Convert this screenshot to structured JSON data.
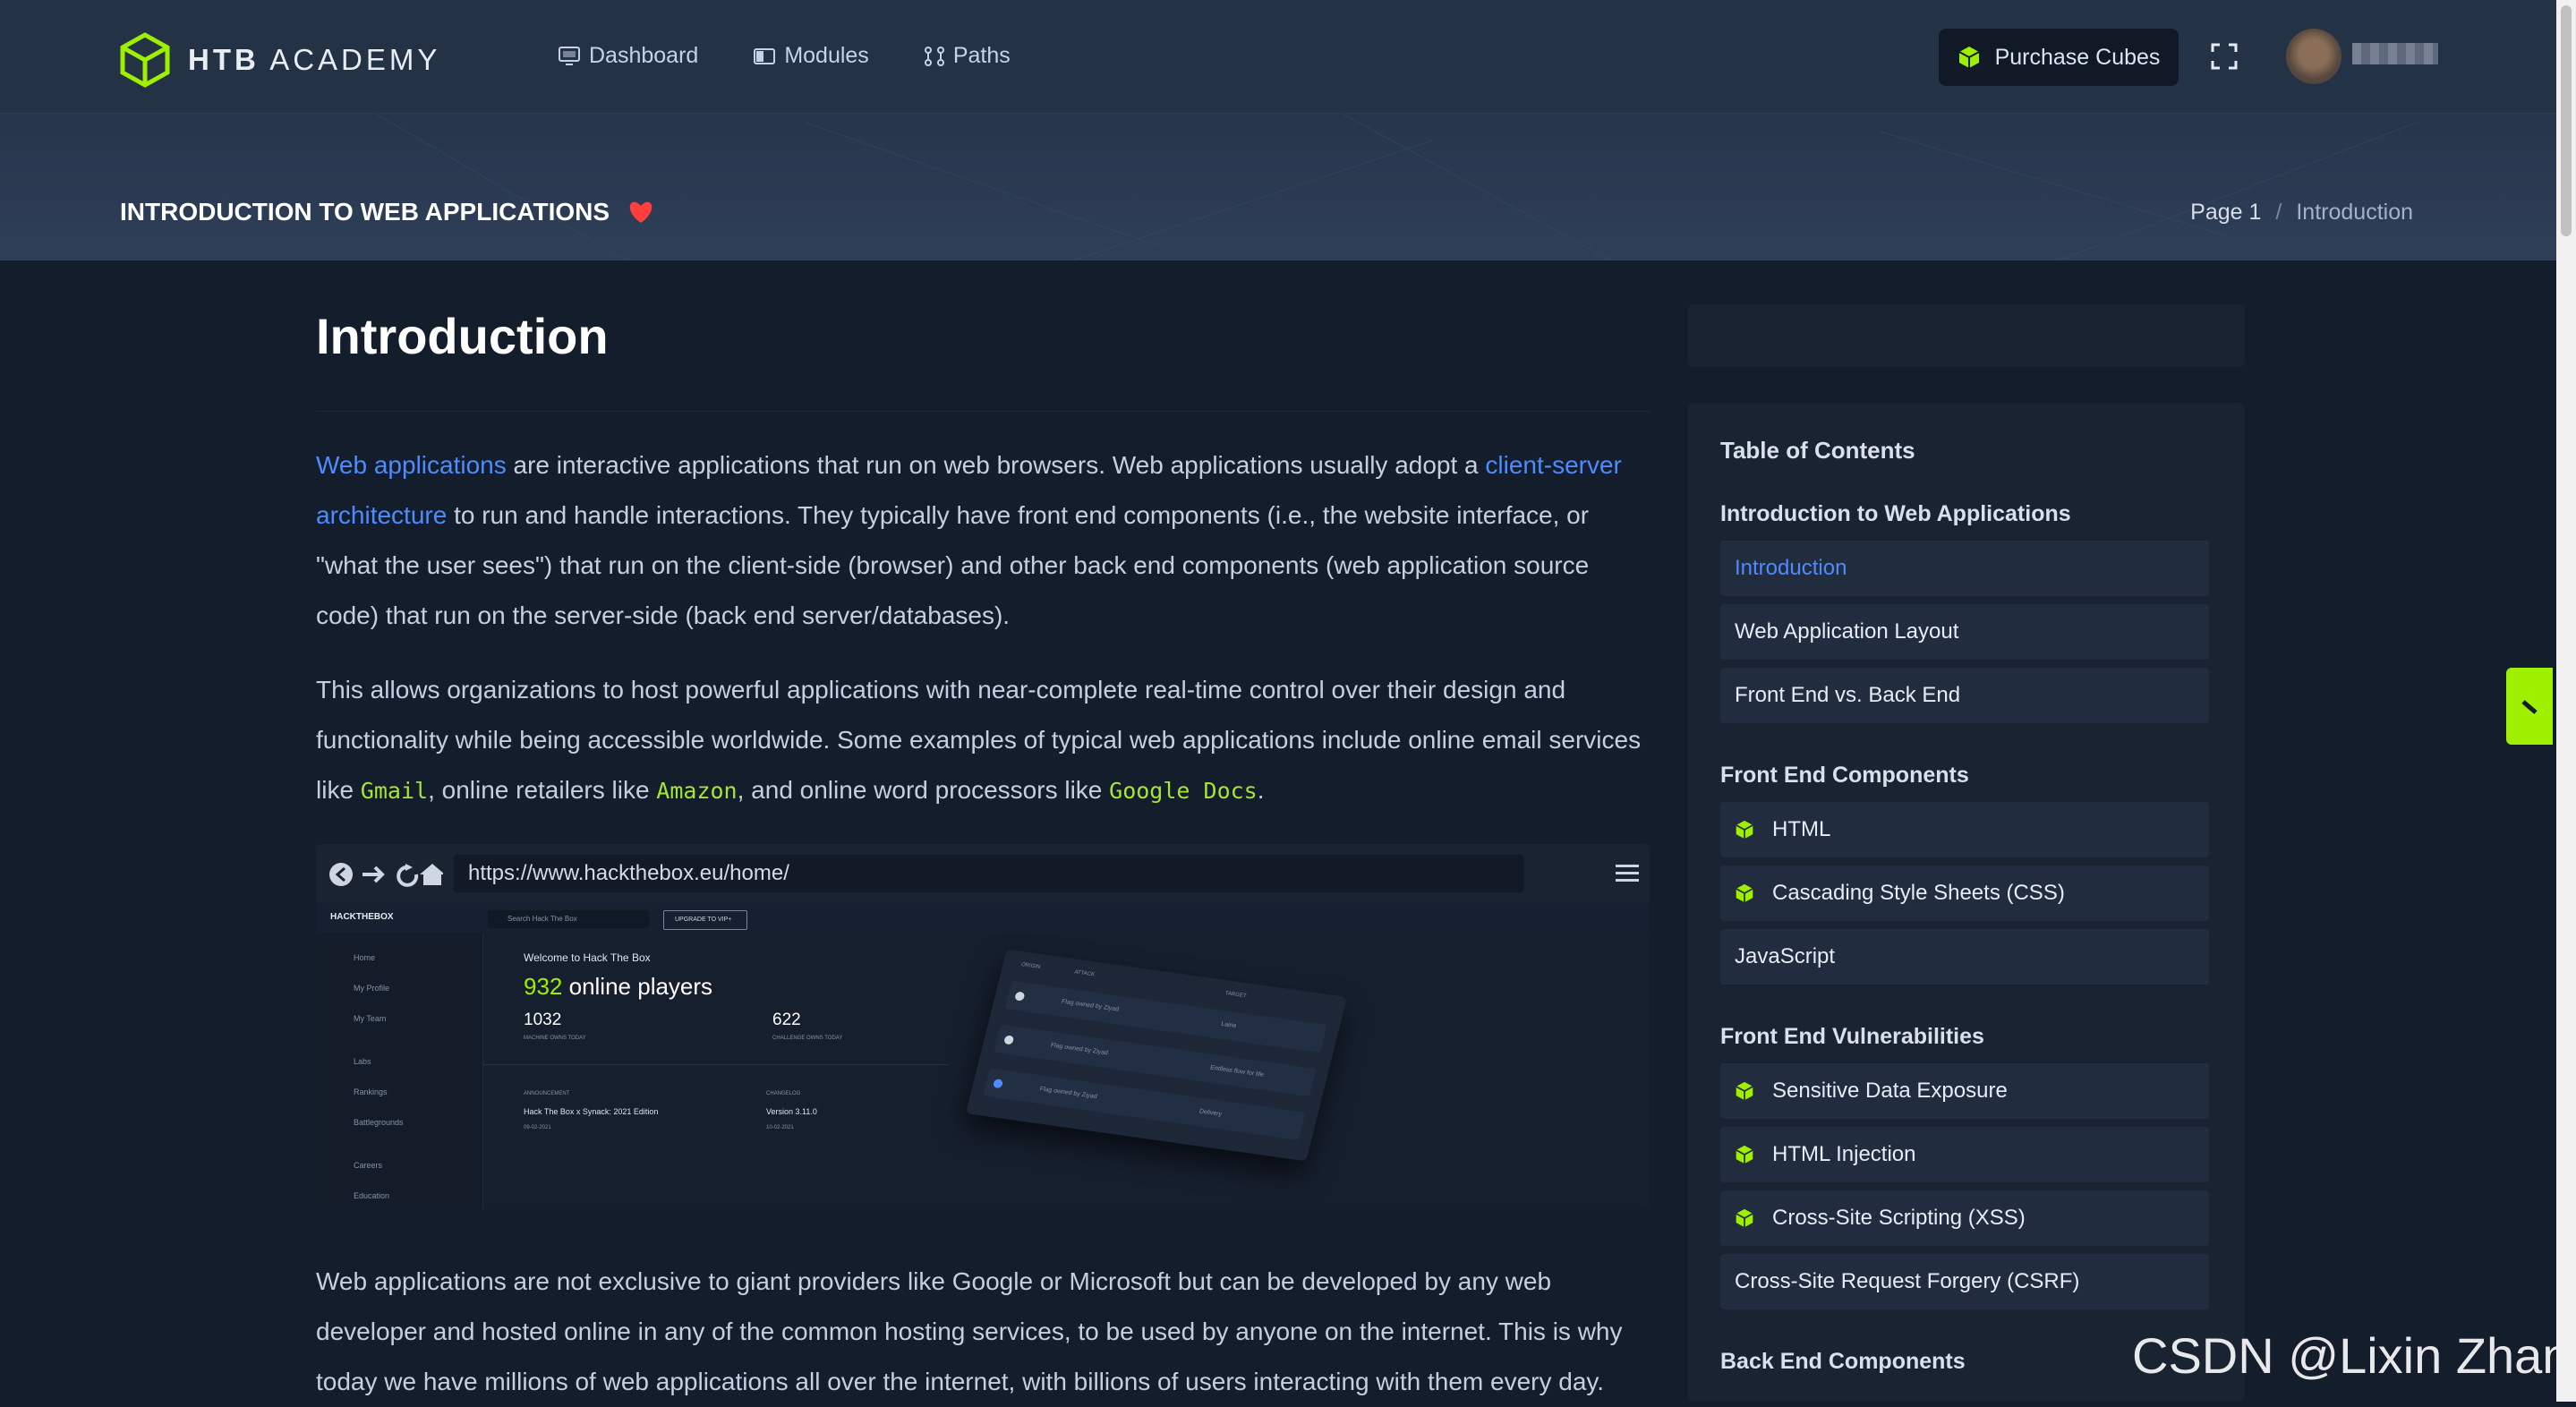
{
  "header": {
    "logo_brand": "HTB",
    "logo_word": "ACADEMY",
    "nav": [
      {
        "label": "Dashboard",
        "icon": "monitor-icon"
      },
      {
        "label": "Modules",
        "icon": "book-icon"
      },
      {
        "label": "Paths",
        "icon": "path-icon"
      }
    ],
    "purchase_label": "Purchase Cubes"
  },
  "banner": {
    "title": "INTRODUCTION TO WEB APPLICATIONS",
    "breadcrumb_page": "Page 1",
    "breadcrumb_sep": "/",
    "breadcrumb_current": "Introduction"
  },
  "content": {
    "heading": "Introduction",
    "p1": {
      "link1": "Web applications",
      "t1": " are interactive applications that run on web browsers. Web applications usually adopt a ",
      "link2": "client-server architecture",
      "t2": " to run and handle interactions. They typically have front end components (i.e., the website interface, or \"what the user sees\") that run on the client-side (browser) and other back end components (web application source code) that run on the server-side (back end server/databases)."
    },
    "p2": {
      "t1": "This allows organizations to host powerful applications with near-complete real-time control over their design and functionality while being accessible worldwide. Some examples of typical web applications include online email services like ",
      "c1": "Gmail",
      "t2": ", online retailers like ",
      "c2": "Amazon",
      "t3": ", and online word processors like ",
      "c3": "Google Docs",
      "t4": "."
    },
    "p3": "Web applications are not exclusive to giant providers like Google or Microsoft but can be developed by any web developer and hosted online in any of the common hosting services, to be used by anyone on the internet. This is why today we have millions of web applications all over the internet, with billions of users interacting with them every day."
  },
  "screenshot": {
    "url": "https://www.hackthebox.eu/home/",
    "brand": "HACKTHEBOX",
    "search_placeholder": "Search Hack The Box",
    "upgrade": "UPGRADE TO VIP+",
    "side": [
      "Home",
      "My Profile",
      "My Team",
      "Labs",
      "Rankings",
      "Battlegrounds",
      "Careers",
      "Education"
    ],
    "welcome": "Welcome to Hack The Box",
    "players_count": "932",
    "players_label": " online players",
    "stat1_value": "1032",
    "stat1_label": "MACHINE OWNS TODAY",
    "stat2_value": "622",
    "stat2_label": "CHALLENGE OWNS TODAY",
    "announce_label": "ANNOUNCEMENT",
    "announce_text": "Hack The Box x Synack: 2021 Edition",
    "announce_date": "09-02-2021",
    "changelog_label": "CHANGELOG",
    "changelog_text": "Version 3.11.0",
    "changelog_date": "10-02-2021",
    "card_headers": [
      "ORIGIN",
      "ATTACK",
      "TARGET"
    ],
    "card_rows": [
      {
        "attack": "Flag owned by Ziyad",
        "target": "Laine"
      },
      {
        "attack": "Flag owned by Ziyad",
        "target": "Endless flow for life"
      },
      {
        "attack": "Flag owned by Ziyad",
        "target": "Delivery"
      }
    ]
  },
  "toc": {
    "title": "Table of Contents",
    "sections": [
      {
        "title": "Introduction to Web Applications",
        "items": [
          {
            "label": "Introduction",
            "active": true,
            "cube": false
          },
          {
            "label": "Web Application Layout",
            "cube": false
          },
          {
            "label": "Front End vs. Back End",
            "cube": false
          }
        ]
      },
      {
        "title": "Front End Components",
        "items": [
          {
            "label": "HTML",
            "cube": true
          },
          {
            "label": "Cascading Style Sheets (CSS)",
            "cube": true
          },
          {
            "label": "JavaScript",
            "cube": false
          }
        ]
      },
      {
        "title": "Front End Vulnerabilities",
        "items": [
          {
            "label": "Sensitive Data Exposure",
            "cube": true
          },
          {
            "label": "HTML Injection",
            "cube": true
          },
          {
            "label": "Cross-Site Scripting (XSS)",
            "cube": true
          },
          {
            "label": "Cross-Site Request Forgery (CSRF)",
            "cube": false
          }
        ]
      },
      {
        "title": "Back End Components",
        "items": []
      }
    ]
  },
  "watermark": "CSDN @Lixin Zhang",
  "colors": {
    "accent_green": "#9fef00",
    "link_blue": "#4d8bff",
    "bg": "#141d2b",
    "heart": "#ff3e3e"
  }
}
